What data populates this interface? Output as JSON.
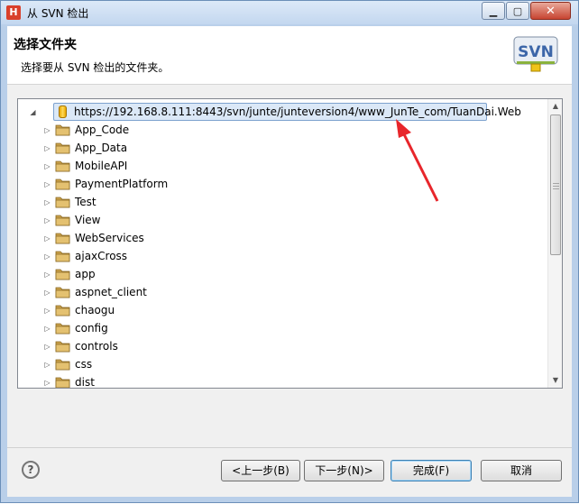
{
  "window": {
    "title": "从 SVN 检出",
    "app_icon_letter": "H"
  },
  "header": {
    "title": "选择文件夹",
    "description": "选择要从 SVN 检出的文件夹。",
    "logo_text": "SVN"
  },
  "tree": {
    "root": "https://192.168.8.111:8443/svn/junte/junteversion4/www_JunTe_com/TuanDai.Web",
    "folders": [
      "App_Code",
      "App_Data",
      "MobileAPI",
      "PaymentPlatform",
      "Test",
      "View",
      "WebServices",
      "ajaxCross",
      "app",
      "aspnet_client",
      "chaogu",
      "config",
      "controls",
      "css",
      "dist"
    ]
  },
  "buttons": {
    "back": "<上一步(B)",
    "next": "下一步(N)>",
    "finish": "完成(F)",
    "cancel": "取消",
    "help": "?"
  },
  "colors": {
    "annotation_arrow": "#e8262b",
    "selection": "#dbe8f7",
    "folder": "#d8a83c"
  }
}
